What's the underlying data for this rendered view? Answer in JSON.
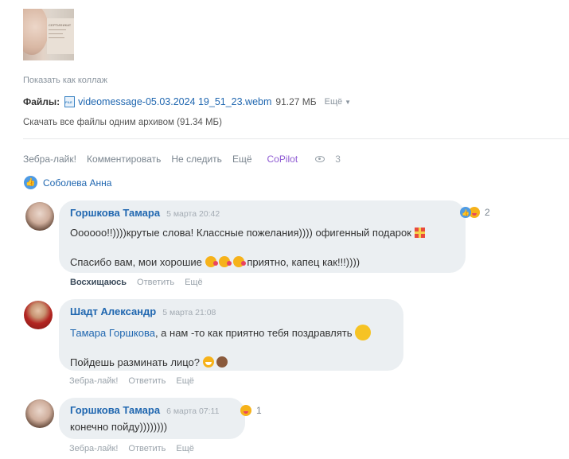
{
  "attachment": {
    "thumbnail_text": "СЕРТИФИКАТ",
    "show_collage": "Показать как коллаж",
    "files_label": "Файлы:",
    "file_name": "videomessage-05.03.2024 19_51_23.webm",
    "file_size": "91.27 МБ",
    "more": "Ещё",
    "download_all": "Скачать все файлы одним архивом (91.34 МБ)"
  },
  "post_actions": {
    "like": "Зебра-лайк!",
    "comment": "Комментировать",
    "unfollow": "Не следить",
    "more": "Ещё",
    "copilot": "CoPilot",
    "views": "3"
  },
  "likers": {
    "name": "Соболева Анна"
  },
  "comments": [
    {
      "author": "Горшкова Тамара",
      "date": "5 марта 20:42",
      "line1": "Оооооо!!))))крутые слова! Классные пожелания)))) офигенный подарок",
      "line2_a": "Спасибо вам, мои хорошие",
      "line2_b": "приятно, капец как!!!))))",
      "reaction_count": "2",
      "actions": [
        "Восхищаюсь",
        "Ответить",
        "Ещё"
      ]
    },
    {
      "author": "Шадт Александр",
      "date": "5 марта 21:08",
      "mention": "Тамара Горшкова",
      "line1": ", а нам -то как приятно тебя поздравлять",
      "line2": "Пойдешь разминать лицо?",
      "actions": [
        "Зебра-лайк!",
        "Ответить",
        "Ещё"
      ]
    },
    {
      "author": "Горшкова Тамара",
      "date": "6 марта 07:11",
      "line1": "конечно пойду))))))))",
      "reaction_count": "1",
      "actions": [
        "Зебра-лайк!",
        "Ответить",
        "Ещё"
      ]
    }
  ],
  "colors": {
    "link": "#2067b0",
    "copilot": "#8f5bd3",
    "bubble": "#ebeff2",
    "like": "#4e9be4"
  }
}
